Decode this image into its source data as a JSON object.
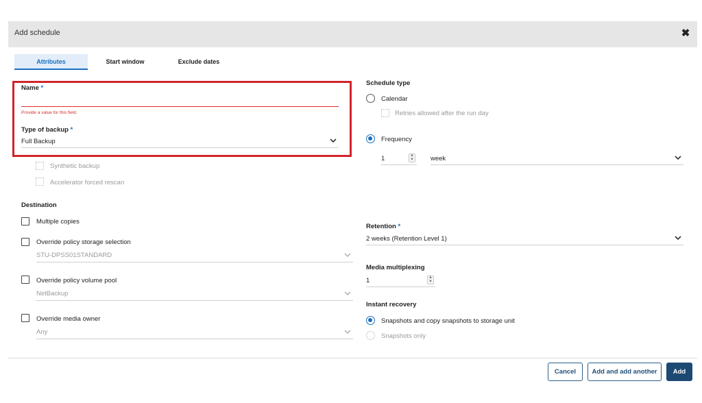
{
  "dialog": {
    "title": "Add schedule",
    "close_icon": "close-icon"
  },
  "tabs": [
    {
      "label": "Attributes",
      "active": true
    },
    {
      "label": "Start window",
      "active": false
    },
    {
      "label": "Exclude dates",
      "active": false
    }
  ],
  "attributes": {
    "name_label": "Name",
    "required_mark": "*",
    "name_value": "",
    "name_error": "Provide a value for this field.",
    "backup_type_label": "Type of backup",
    "backup_type_value": "Full Backup",
    "synthetic_backup_label": "Synthetic backup",
    "accelerator_label": "Accelerator forced rescan"
  },
  "destination": {
    "heading": "Destination",
    "multiple_copies_label": "Multiple copies",
    "override_storage_label": "Override policy storage selection",
    "storage_value": "STU-DPSS01STANDARD",
    "override_volume_label": "Override policy volume pool",
    "volume_value": "NetBackup",
    "override_media_owner_label": "Override media owner",
    "media_owner_value": "Any"
  },
  "schedule_type": {
    "heading": "Schedule type",
    "calendar_label": "Calendar",
    "retries_label": "Retries allowed after the run day",
    "frequency_label": "Frequency",
    "frequency_number": "1",
    "frequency_unit": "week",
    "selected": "Frequency"
  },
  "retention": {
    "label": "Retention",
    "value": "2 weeks (Retention Level 1)"
  },
  "media_multiplexing": {
    "label": "Media multiplexing",
    "value": "1"
  },
  "instant_recovery": {
    "heading": "Instant recovery",
    "option1_label": "Snapshots and copy snapshots to storage unit",
    "option2_label": "Snapshots only",
    "selected": "Snapshots and copy snapshots to storage unit"
  },
  "footer": {
    "cancel_label": "Cancel",
    "add_another_label": "Add and add another",
    "add_label": "Add"
  },
  "colors": {
    "accent": "#1a6fc0",
    "error": "#d22c2c",
    "highlight_box": "#d2232a",
    "primary_button": "#1d4a73"
  }
}
